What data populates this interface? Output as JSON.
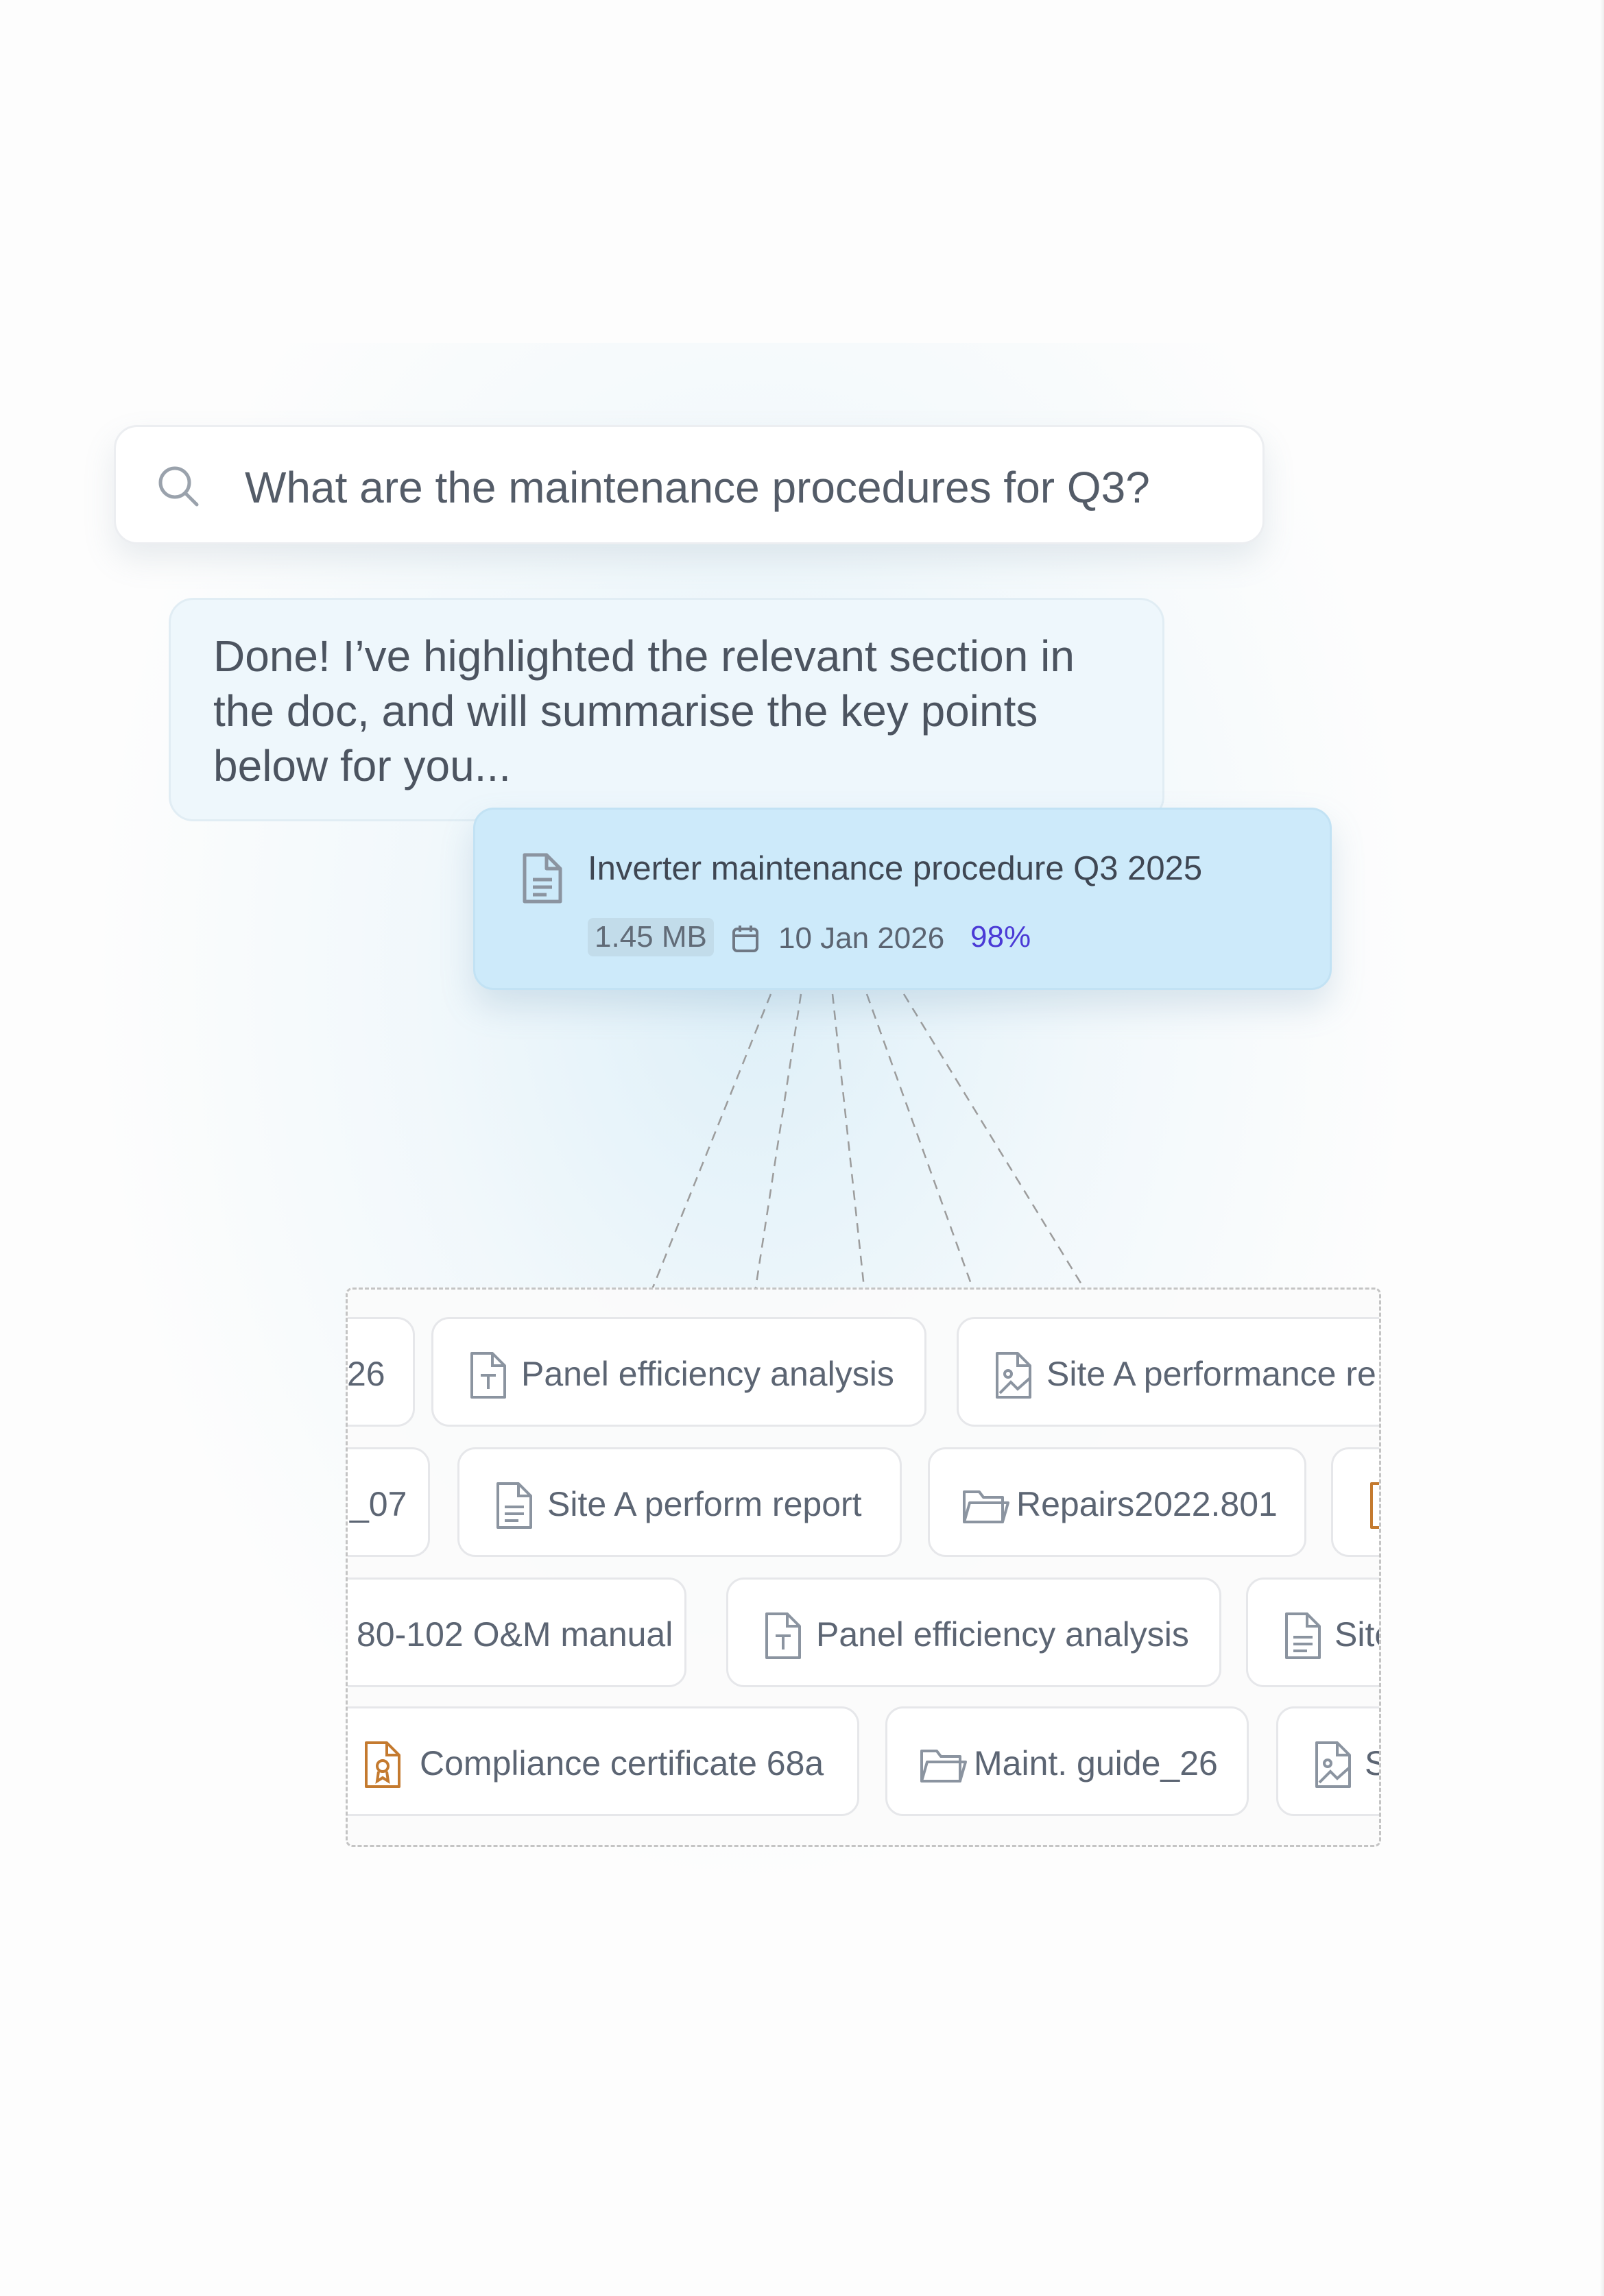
{
  "search": {
    "icon": "search-icon",
    "query": "What are the maintenance procedures for Q3?"
  },
  "response": {
    "text": "Done! I’ve highlighted the relevant section in the doc, and will summarise the key points below for you..."
  },
  "document": {
    "icon": "document-icon",
    "title": "Inverter maintenance procedure Q3 2025",
    "size": "1.45 MB",
    "date_icon": "calendar-icon",
    "date": "10 Jan 2026",
    "score": "98%"
  },
  "results": {
    "rows": [
      [
        {
          "label": "26",
          "icon": ""
        },
        {
          "label": "Panel efficiency analysis",
          "icon": "text-file-icon"
        },
        {
          "label": "Site A performance re",
          "icon": "image-file-icon"
        }
      ],
      [
        {
          "label": "_07",
          "icon": ""
        },
        {
          "label": "Site A perform report",
          "icon": "document-icon"
        },
        {
          "label": "Repairs2022.801",
          "icon": "folder-icon"
        },
        {
          "label": "",
          "icon": "certificate-icon"
        }
      ],
      [
        {
          "label": "80-102 O&M manual",
          "icon": ""
        },
        {
          "label": "Panel efficiency analysis",
          "icon": "text-file-icon"
        },
        {
          "label": "Site",
          "icon": "document-icon"
        }
      ],
      [
        {
          "label": "Compliance certificate 68a",
          "icon": "certificate-icon"
        },
        {
          "label": "Maint. guide_26",
          "icon": "folder-icon"
        },
        {
          "label": "S",
          "icon": "image-file-icon"
        }
      ]
    ]
  },
  "colors": {
    "score": "#4a3ad6",
    "doc_card_bg": "#cdeafa",
    "bubble_bg": "#eef7fc",
    "certificate_icon": "#c47a2f"
  }
}
